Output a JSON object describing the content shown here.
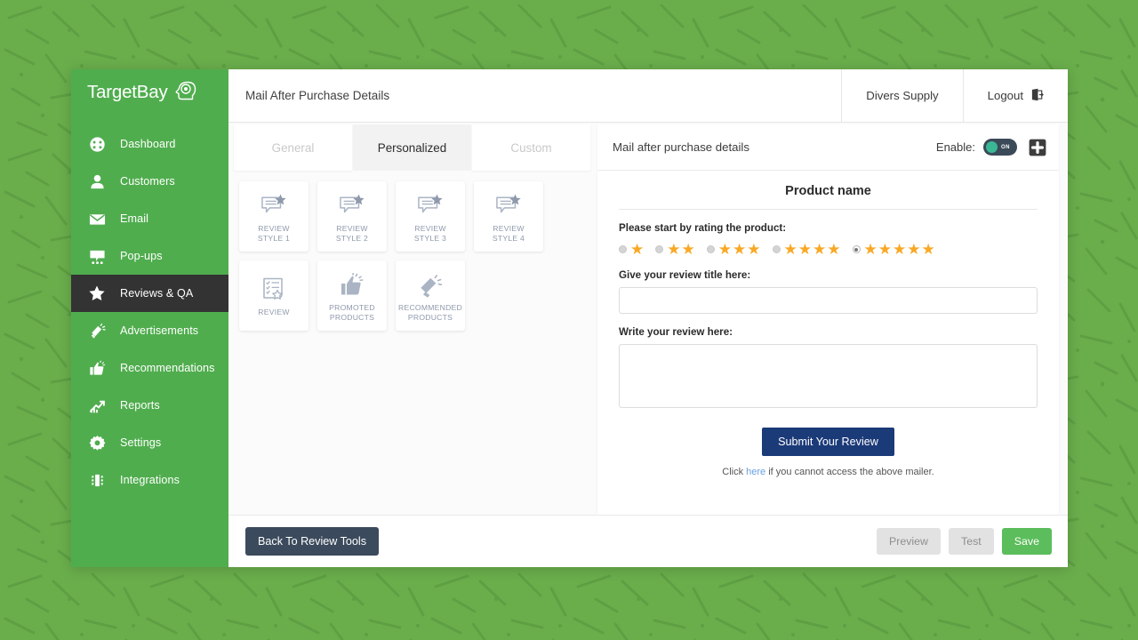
{
  "theme": {
    "background_green": "#6aae4c",
    "sidebar_green": "#50ad4e",
    "sidebar_active": "#333333",
    "star_gold": "#f9a825",
    "submit_blue": "#1b3a78",
    "save_green": "#5bbd5b",
    "toggle_track": "#3b4a59",
    "toggle_knob_teal": "#3ab795"
  },
  "sidebar": {
    "brand": "TargetBay",
    "brand_icon": "brain-head-target-icon",
    "items": [
      {
        "label": "Dashboard",
        "icon": "dashboard-gauge-icon",
        "active": false
      },
      {
        "label": "Customers",
        "icon": "user-person-icon",
        "active": false
      },
      {
        "label": "Email",
        "icon": "envelope-icon",
        "active": false
      },
      {
        "label": "Pop-ups",
        "icon": "popup-screen-icon",
        "active": false
      },
      {
        "label": "Reviews & QA",
        "icon": "star-icon",
        "active": true
      },
      {
        "label": "Advertisements",
        "icon": "megaphone-icon",
        "active": false
      },
      {
        "label": "Recommendations",
        "icon": "thumbs-up-icon",
        "active": false
      },
      {
        "label": "Reports",
        "icon": "growth-chart-icon",
        "active": false
      },
      {
        "label": "Settings",
        "icon": "gear-icon",
        "active": false
      },
      {
        "label": "Integrations",
        "icon": "integrations-plug-icon",
        "active": false
      }
    ]
  },
  "topbar": {
    "title": "Mail After Purchase Details",
    "store_name": "Divers Supply",
    "logout_label": "Logout",
    "logout_icon": "logout-door-arrow-icon"
  },
  "tabs": [
    {
      "label": "General",
      "active": false
    },
    {
      "label": "Personalized",
      "active": true
    },
    {
      "label": "Custom",
      "active": false
    }
  ],
  "style_cards": [
    {
      "label": "REVIEW\nSTYLE 1",
      "icon": "review-bubble-star-icon"
    },
    {
      "label": "REVIEW\nSTYLE 2",
      "icon": "review-bubble-star-icon"
    },
    {
      "label": "REVIEW\nSTYLE 3",
      "icon": "review-bubble-star-icon"
    },
    {
      "label": "REVIEW\nSTYLE 4",
      "icon": "review-bubble-star-icon"
    },
    {
      "label": "REVIEW",
      "icon": "checklist-star-icon"
    },
    {
      "label": "PROMOTED\nPRODUCTS",
      "icon": "thumbs-up-icon"
    },
    {
      "label": "RECOMMENDED\nPRODUCTS",
      "icon": "megaphone-icon"
    }
  ],
  "preview": {
    "header_title": "Mail after purchase details",
    "enable_label": "Enable:",
    "toggle_state": "ON",
    "add_icon": "plus-square-icon",
    "product_name": "Product name",
    "rating_prompt": "Please start by rating the product:",
    "rating_options": [
      {
        "stars": 1,
        "selected": false
      },
      {
        "stars": 2,
        "selected": false
      },
      {
        "stars": 3,
        "selected": false
      },
      {
        "stars": 4,
        "selected": false
      },
      {
        "stars": 5,
        "selected": true
      }
    ],
    "title_label": "Give your review title here:",
    "title_value": "",
    "title_placeholder": "",
    "body_label": "Write your review here:",
    "body_value": "",
    "body_placeholder": "",
    "submit_label": "Submit Your Review",
    "note_prefix": "Click ",
    "note_link": "here",
    "note_suffix": " if you cannot access the above mailer."
  },
  "footer": {
    "back_label": "Back To Review Tools",
    "preview_label": "Preview",
    "test_label": "Test",
    "save_label": "Save"
  }
}
